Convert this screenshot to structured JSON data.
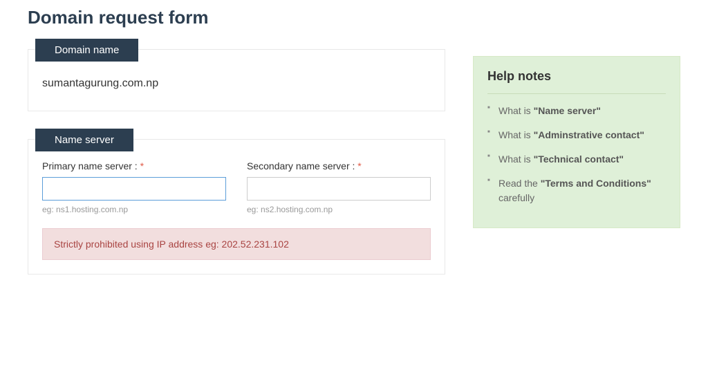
{
  "page": {
    "title": "Domain request form"
  },
  "domain_panel": {
    "header": "Domain name",
    "value": "sumantagurung.com.np"
  },
  "ns_panel": {
    "header": "Name server",
    "primary": {
      "label": "Primary name server : ",
      "required": "*",
      "value": "",
      "hint": "eg: ns1.hosting.com.np"
    },
    "secondary": {
      "label": "Secondary name server : ",
      "required": "*",
      "value": "",
      "hint": "eg: ns2.hosting.com.np"
    },
    "warning": "Strictly prohibited using IP address eg: 202.52.231.102"
  },
  "help": {
    "title": "Help notes",
    "items": [
      {
        "prefix": "What is ",
        "em": "\"Name server\"",
        "suffix": ""
      },
      {
        "prefix": "What is ",
        "em": "\"Adminstrative contact\"",
        "suffix": ""
      },
      {
        "prefix": "What is ",
        "em": "\"Technical contact\"",
        "suffix": ""
      },
      {
        "prefix": "Read the ",
        "em": "\"Terms and Conditions\"",
        "suffix": " carefully"
      }
    ]
  }
}
